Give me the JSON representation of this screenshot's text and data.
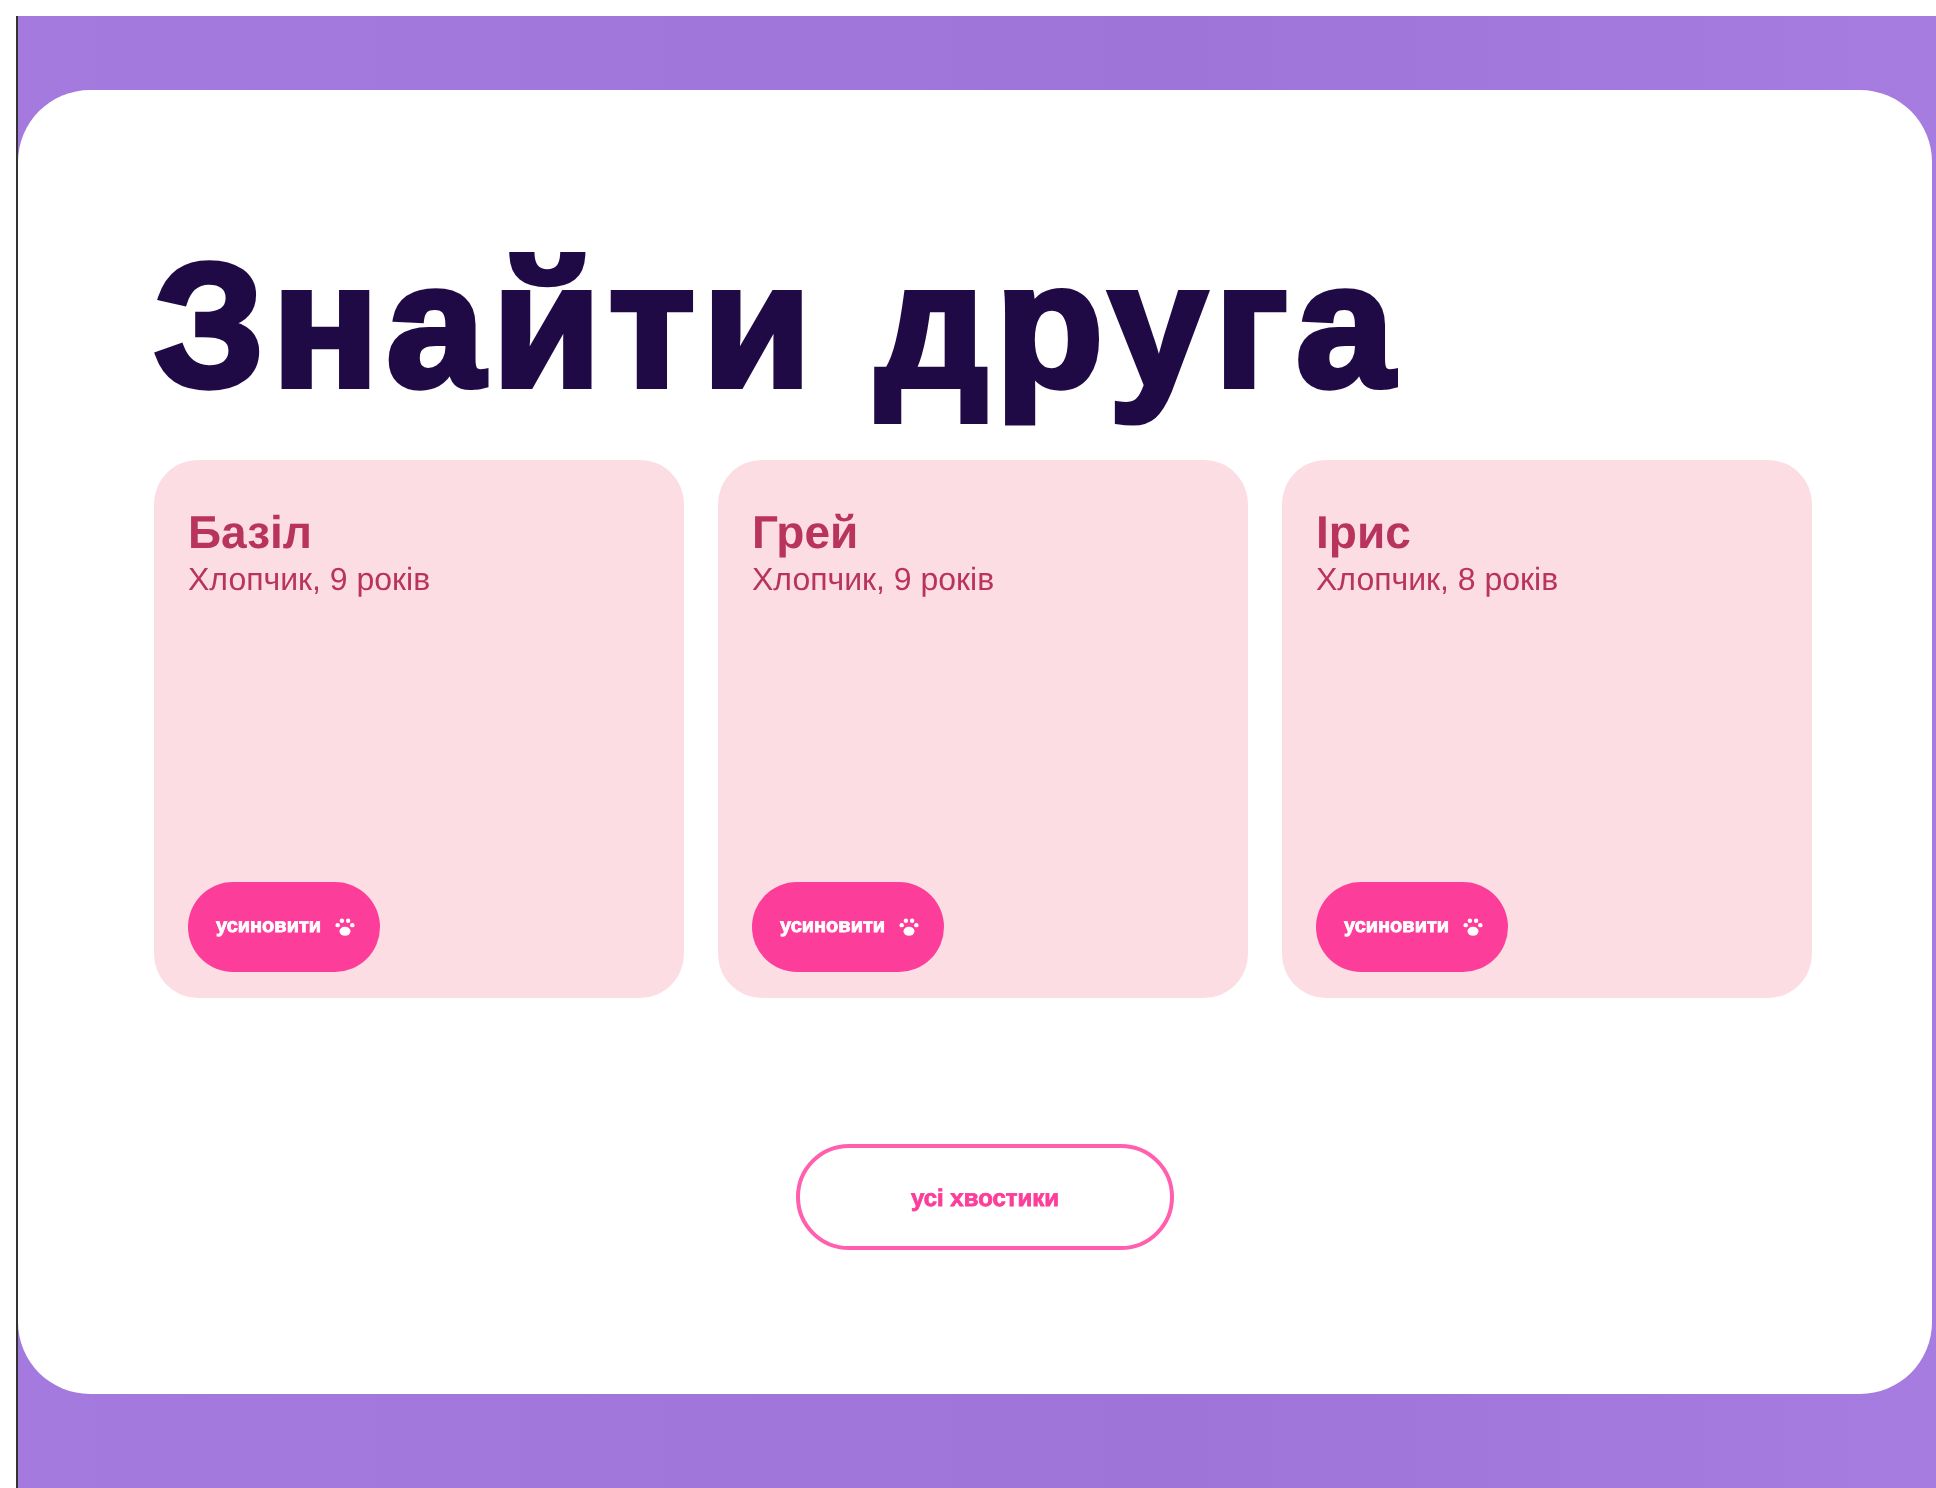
{
  "title": "Знайти друга",
  "pets": [
    {
      "name": "Базіл",
      "info": "Хлопчик, 9 років",
      "button": "усиновити"
    },
    {
      "name": "Грей",
      "info": "Хлопчик, 9 років",
      "button": "усиновити"
    },
    {
      "name": "Ірис",
      "info": "Хлопчик, 8 років",
      "button": "усиновити"
    }
  ],
  "all_button": "усі хвостики"
}
